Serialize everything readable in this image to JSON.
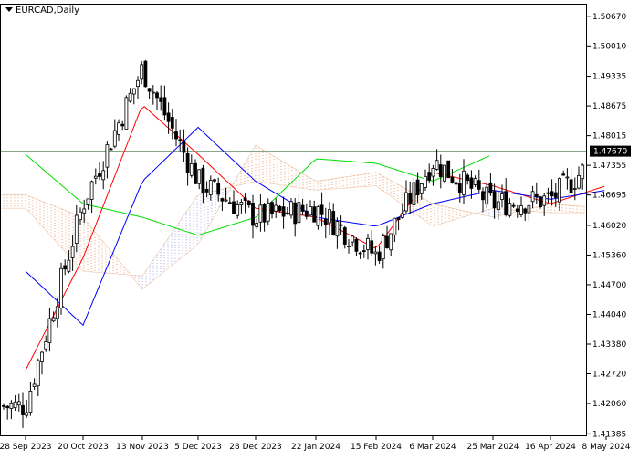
{
  "chart_data": {
    "type": "line",
    "title": "EURCAD,Daily",
    "current_price": "1.47670",
    "colors": {
      "background": "#ffffff",
      "axis": "#000000",
      "candle": "#000000",
      "tenkan": "#ff0000",
      "kijun": "#0000ff",
      "chikou": "#00dd00",
      "cloud": "#e8a070",
      "cloud_alt": "#a8a8e8",
      "price_line": "#7a9a7a",
      "price_label_bg": "#000000"
    },
    "ylim": [
      1.4133,
      1.5095
    ],
    "y_ticks": [
      "1.50670",
      "1.50010",
      "1.49335",
      "1.48675",
      "1.48015",
      "1.47355",
      "1.46695",
      "1.46020",
      "1.45360",
      "1.44700",
      "1.44040",
      "1.43380",
      "1.42720",
      "1.42060",
      "1.41385"
    ],
    "x_labels": [
      "28 Sep 2023",
      "20 Oct 2023",
      "13 Nov 2023",
      "5 Dec 2023",
      "28 Dec 2023",
      "22 Jan 2024",
      "15 Feb 2024",
      "6 Mar 2024",
      "25 Mar 2024",
      "16 Apr 2024",
      "8 May 2024"
    ],
    "close_by_label": [
      1.42,
      1.465,
      1.495,
      1.47,
      1.462,
      1.464,
      1.4535,
      1.4745,
      1.465,
      1.466,
      1.4767
    ],
    "tenkan_by_label": [
      1.428,
      1.453,
      1.487,
      1.476,
      1.464,
      1.462,
      1.455,
      1.472,
      1.469,
      1.465,
      1.469
    ],
    "kijun_by_label": [
      1.45,
      1.438,
      1.47,
      1.482,
      1.47,
      1.462,
      1.46,
      1.465,
      1.468,
      1.466,
      1.468
    ],
    "chikou_by_label": [
      1.476,
      1.465,
      1.462,
      1.458,
      1.462,
      1.475,
      1.474,
      1.47,
      1.476
    ],
    "cloud_a_by_label": [
      1.467,
      1.462,
      1.446,
      1.456,
      1.478,
      1.47,
      1.472,
      1.465,
      1.462,
      1.465,
      1.464
    ],
    "cloud_b_by_label": [
      1.464,
      1.45,
      1.449,
      1.467,
      1.47,
      1.468,
      1.469,
      1.46,
      1.464,
      1.463,
      1.463
    ]
  }
}
